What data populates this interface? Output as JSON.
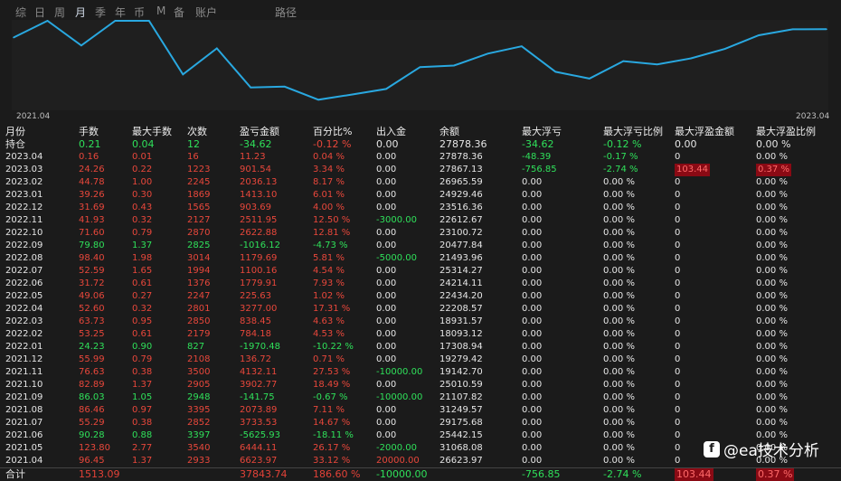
{
  "tabs": [
    {
      "label": "综",
      "active": false
    },
    {
      "label": "日",
      "active": false
    },
    {
      "label": "周",
      "active": false
    },
    {
      "label": "月",
      "active": true
    },
    {
      "label": "季",
      "active": false
    },
    {
      "label": "年",
      "active": false
    },
    {
      "label": "币",
      "active": false
    },
    {
      "label": "M",
      "active": false
    },
    {
      "label": "备",
      "active": false
    },
    {
      "label": "账户",
      "active": false
    },
    {
      "label": "路径",
      "active": false
    }
  ],
  "chart_data": {
    "type": "line",
    "x_start_label": "2021.04",
    "x_end_label": "2023.04",
    "line_color": "#29a8e0",
    "x": [
      "2021.04",
      "2021.05",
      "2021.06",
      "2021.07",
      "2021.08",
      "2021.09",
      "2021.10",
      "2021.11",
      "2021.12",
      "2022.01",
      "2022.02",
      "2022.03",
      "2022.04",
      "2022.05",
      "2022.06",
      "2022.07",
      "2022.08",
      "2022.09",
      "2022.10",
      "2022.11",
      "2022.12",
      "2023.01",
      "2023.02",
      "2023.03",
      "2023.04"
    ],
    "values": [
      26623.97,
      31068.08,
      25442.15,
      29175.68,
      31249.57,
      21107.82,
      25010.59,
      19142.7,
      19279.42,
      17308.94,
      18093.12,
      18931.57,
      22208.57,
      22434.2,
      24214.11,
      25314.27,
      21493.96,
      20477.84,
      23100.72,
      22612.67,
      23516.36,
      24929.46,
      26965.59,
      27867.13,
      27878.36
    ],
    "ylim": [
      16000,
      29000
    ]
  },
  "table": {
    "headers": [
      "月份",
      "手数",
      "最大手数",
      "次数",
      "盈亏金额",
      "百分比%",
      "出入金",
      "余额",
      "最大浮亏",
      "最大浮亏比例",
      "最大浮盈金额",
      "最大浮盈比例"
    ],
    "holding": {
      "label": "持仓",
      "values": [
        "0.21",
        "0.04",
        "12",
        "-34.62",
        "-0.12 %",
        "0.00",
        "27878.36",
        "-34.62",
        "-0.12 %",
        "0.00",
        "0.00 %"
      ]
    },
    "rows": [
      {
        "cells": [
          "2023.04",
          "0.16",
          "0.01",
          "16",
          "11.23",
          "0.04 %",
          "0.00",
          "27878.36",
          "-48.39",
          "-0.17 %",
          "0",
          "0.00 %"
        ],
        "pnl": "pos"
      },
      {
        "cells": [
          "2023.03",
          "24.26",
          "0.22",
          "1223",
          "901.54",
          "3.34 %",
          "0.00",
          "27867.13",
          "-756.85",
          "-2.74 %",
          "103.44",
          "0.37 %"
        ],
        "pnl": "pos"
      },
      {
        "cells": [
          "2023.02",
          "44.78",
          "1.00",
          "2245",
          "2036.13",
          "8.17 %",
          "0.00",
          "26965.59",
          "0.00",
          "0.00 %",
          "0",
          "0.00 %"
        ],
        "pnl": "pos"
      },
      {
        "cells": [
          "2023.01",
          "39.26",
          "0.30",
          "1869",
          "1413.10",
          "6.01 %",
          "0.00",
          "24929.46",
          "0.00",
          "0.00 %",
          "0",
          "0.00 %"
        ],
        "pnl": "pos"
      },
      {
        "cells": [
          "2022.12",
          "31.69",
          "0.43",
          "1565",
          "903.69",
          "4.00 %",
          "0.00",
          "23516.36",
          "0.00",
          "0.00 %",
          "0",
          "0.00 %"
        ],
        "pnl": "pos"
      },
      {
        "cells": [
          "2022.11",
          "41.93",
          "0.32",
          "2127",
          "2511.95",
          "12.50 %",
          "-3000.00",
          "22612.67",
          "0.00",
          "0.00 %",
          "0",
          "0.00 %"
        ],
        "pnl": "pos"
      },
      {
        "cells": [
          "2022.10",
          "71.60",
          "0.79",
          "2870",
          "2622.88",
          "12.81 %",
          "0.00",
          "23100.72",
          "0.00",
          "0.00 %",
          "0",
          "0.00 %"
        ],
        "pnl": "pos"
      },
      {
        "cells": [
          "2022.09",
          "79.80",
          "1.37",
          "2825",
          "-1016.12",
          "-4.73 %",
          "0.00",
          "20477.84",
          "0.00",
          "0.00 %",
          "0",
          "0.00 %"
        ],
        "pnl": "neg"
      },
      {
        "cells": [
          "2022.08",
          "98.40",
          "1.98",
          "3014",
          "1179.69",
          "5.81 %",
          "-5000.00",
          "21493.96",
          "0.00",
          "0.00 %",
          "0",
          "0.00 %"
        ],
        "pnl": "pos"
      },
      {
        "cells": [
          "2022.07",
          "52.59",
          "1.65",
          "1994",
          "1100.16",
          "4.54 %",
          "0.00",
          "25314.27",
          "0.00",
          "0.00 %",
          "0",
          "0.00 %"
        ],
        "pnl": "pos"
      },
      {
        "cells": [
          "2022.06",
          "31.72",
          "0.61",
          "1376",
          "1779.91",
          "7.93 %",
          "0.00",
          "24214.11",
          "0.00",
          "0.00 %",
          "0",
          "0.00 %"
        ],
        "pnl": "pos"
      },
      {
        "cells": [
          "2022.05",
          "49.06",
          "0.27",
          "2247",
          "225.63",
          "1.02 %",
          "0.00",
          "22434.20",
          "0.00",
          "0.00 %",
          "0",
          "0.00 %"
        ],
        "pnl": "pos"
      },
      {
        "cells": [
          "2022.04",
          "52.60",
          "0.32",
          "2801",
          "3277.00",
          "17.31 %",
          "0.00",
          "22208.57",
          "0.00",
          "0.00 %",
          "0",
          "0.00 %"
        ],
        "pnl": "pos"
      },
      {
        "cells": [
          "2022.03",
          "63.73",
          "0.95",
          "2850",
          "838.45",
          "4.63 %",
          "0.00",
          "18931.57",
          "0.00",
          "0.00 %",
          "0",
          "0.00 %"
        ],
        "pnl": "pos"
      },
      {
        "cells": [
          "2022.02",
          "53.25",
          "0.61",
          "2179",
          "784.18",
          "4.53 %",
          "0.00",
          "18093.12",
          "0.00",
          "0.00 %",
          "0",
          "0.00 %"
        ],
        "pnl": "pos"
      },
      {
        "cells": [
          "2022.01",
          "24.23",
          "0.90",
          "827",
          "-1970.48",
          "-10.22 %",
          "0.00",
          "17308.94",
          "0.00",
          "0.00 %",
          "0",
          "0.00 %"
        ],
        "pnl": "neg"
      },
      {
        "cells": [
          "2021.12",
          "55.99",
          "0.79",
          "2108",
          "136.72",
          "0.71 %",
          "0.00",
          "19279.42",
          "0.00",
          "0.00 %",
          "0",
          "0.00 %"
        ],
        "pnl": "pos"
      },
      {
        "cells": [
          "2021.11",
          "76.63",
          "0.38",
          "3500",
          "4132.11",
          "27.53 %",
          "-10000.00",
          "19142.70",
          "0.00",
          "0.00 %",
          "0",
          "0.00 %"
        ],
        "pnl": "pos"
      },
      {
        "cells": [
          "2021.10",
          "82.89",
          "1.37",
          "2905",
          "3902.77",
          "18.49 %",
          "0.00",
          "25010.59",
          "0.00",
          "0.00 %",
          "0",
          "0.00 %"
        ],
        "pnl": "pos"
      },
      {
        "cells": [
          "2021.09",
          "86.03",
          "1.05",
          "2948",
          "-141.75",
          "-0.67 %",
          "-10000.00",
          "21107.82",
          "0.00",
          "0.00 %",
          "0",
          "0.00 %"
        ],
        "pnl": "neg"
      },
      {
        "cells": [
          "2021.08",
          "86.46",
          "0.97",
          "3395",
          "2073.89",
          "7.11 %",
          "0.00",
          "31249.57",
          "0.00",
          "0.00 %",
          "0",
          "0.00 %"
        ],
        "pnl": "pos"
      },
      {
        "cells": [
          "2021.07",
          "55.29",
          "0.38",
          "2852",
          "3733.53",
          "14.67 %",
          "0.00",
          "29175.68",
          "0.00",
          "0.00 %",
          "0",
          "0.00 %"
        ],
        "pnl": "pos"
      },
      {
        "cells": [
          "2021.06",
          "90.28",
          "0.88",
          "3397",
          "-5625.93",
          "-18.11 %",
          "0.00",
          "25442.15",
          "0.00",
          "0.00 %",
          "0",
          "0.00 %"
        ],
        "pnl": "neg"
      },
      {
        "cells": [
          "2021.05",
          "123.80",
          "2.77",
          "3540",
          "6444.11",
          "26.17 %",
          "-2000.00",
          "31068.08",
          "0.00",
          "0.00 %",
          "0",
          "0.00 %"
        ],
        "pnl": "pos"
      },
      {
        "cells": [
          "2021.04",
          "96.45",
          "1.37",
          "2933",
          "6623.97",
          "33.12 %",
          "20000.00",
          "26623.97",
          "0.00",
          "0.00 %",
          "0",
          "0.00 %"
        ],
        "pnl": "pos"
      }
    ],
    "total": {
      "label": "合计",
      "values": [
        "1513.09",
        "",
        "",
        "37843.74",
        "186.60 %",
        "-10000.00",
        "",
        "-756.85",
        "-2.74 %",
        "103.44",
        "0.37 %"
      ]
    }
  },
  "watermark": {
    "logo_glyph": "f",
    "text": "@ea技术分析"
  },
  "colors": {
    "background": "#1b1b1b",
    "red": "#e8473b",
    "green": "#2fe05a",
    "line": "#29a8e0"
  }
}
